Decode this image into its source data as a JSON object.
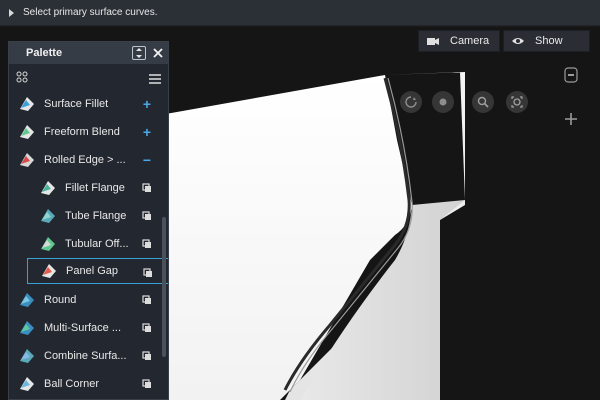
{
  "prompt_bar": {
    "text": "Select primary surface curves."
  },
  "view_toolbar": {
    "camera_label": "Camera",
    "show_label": "Show"
  },
  "palette": {
    "title": "Palette",
    "items": [
      {
        "label": "Surface Fillet",
        "action": "+",
        "indent": false
      },
      {
        "label": "Freeform Blend",
        "action": "+",
        "indent": false
      },
      {
        "label": "Rolled Edge > ...",
        "action": "−",
        "indent": false
      },
      {
        "label": "Fillet Flange",
        "action": "options",
        "indent": true
      },
      {
        "label": "Tube Flange",
        "action": "options",
        "indent": true
      },
      {
        "label": "Tubular Off...",
        "action": "options",
        "indent": true
      },
      {
        "label": "Panel Gap",
        "action": "options",
        "indent": true,
        "selected": true
      },
      {
        "label": "Round",
        "action": "options",
        "indent": false
      },
      {
        "label": "Multi-Surface ...",
        "action": "options",
        "indent": false
      },
      {
        "label": "Combine Surfa...",
        "action": "options",
        "indent": false
      },
      {
        "label": "Ball Corner",
        "action": "options",
        "indent": false
      }
    ]
  },
  "colors": {
    "accent": "#3aa0d8",
    "panel_bg": "#232830",
    "header_bg": "#353c46",
    "plus": "#4aa8e8"
  }
}
